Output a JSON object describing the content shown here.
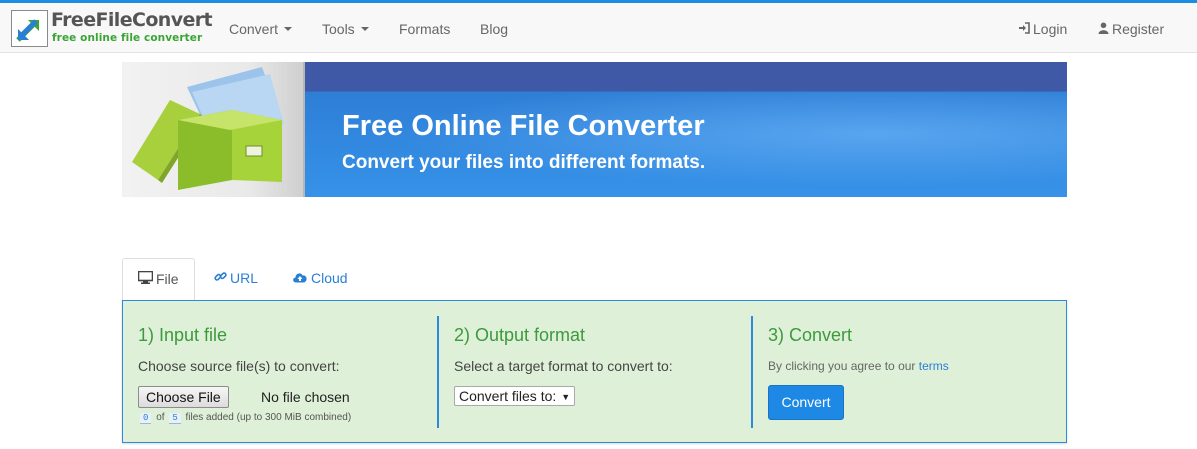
{
  "brand": {
    "name": "FreeFileConvert",
    "tagline": "free online file converter"
  },
  "nav": {
    "items": [
      {
        "label": "Convert",
        "dropdown": true
      },
      {
        "label": "Tools",
        "dropdown": true
      },
      {
        "label": "Formats",
        "dropdown": false
      },
      {
        "label": "Blog",
        "dropdown": false
      }
    ],
    "login": "Login",
    "register": "Register"
  },
  "banner": {
    "title": "Free Online File Converter",
    "subtitle": "Convert your files into different formats."
  },
  "tabs": [
    {
      "label": "File",
      "icon": "monitor-icon",
      "active": true
    },
    {
      "label": "URL",
      "icon": "link-icon",
      "active": false
    },
    {
      "label": "Cloud",
      "icon": "cloud-upload-icon",
      "active": false
    }
  ],
  "step1": {
    "heading": "1) Input file",
    "instruction": "Choose source file(s) to convert:",
    "choose_button": "Choose File",
    "file_status": "No file chosen",
    "files_added": "0",
    "files_of": "of",
    "files_max": "5",
    "files_note": "files added (up to 300 MiB combined)"
  },
  "step2": {
    "heading": "2) Output format",
    "instruction": "Select a target format to convert to:",
    "select_value": "Convert files to:"
  },
  "step3": {
    "heading": "3) Convert",
    "agree_text": "By clicking you agree to our",
    "terms_link": "terms",
    "convert_button": "Convert"
  },
  "colors": {
    "accent": "#1e88e5",
    "panel_bg": "#dff0d8",
    "heading_green": "#3c9a3c",
    "banner_blue": "#3692e8"
  }
}
